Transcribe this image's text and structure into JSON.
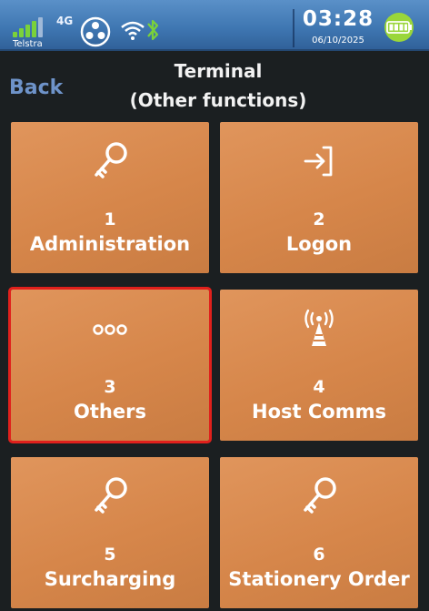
{
  "status_bar": {
    "network_type": "4G",
    "carrier": "Telstra",
    "time": "03:28",
    "date": "06/10/2025",
    "icons": [
      "signal-icon",
      "nfc-icon",
      "wifi-icon",
      "bluetooth-icon",
      "battery-icon"
    ],
    "colors": {
      "bar": "#3f77b2",
      "signal": "#7ad23a",
      "battery": "#9ad63a"
    }
  },
  "header": {
    "back_label": "Back",
    "title_line1": "Terminal",
    "title_line2": "(Other functions)"
  },
  "menu": {
    "items": [
      {
        "number": "1",
        "label": "Administration",
        "icon": "key-icon"
      },
      {
        "number": "2",
        "label": "Logon",
        "icon": "login-icon"
      },
      {
        "number": "3",
        "label": "Others",
        "icon": "more-icon",
        "selected": true
      },
      {
        "number": "4",
        "label": "Host Comms",
        "icon": "antenna-icon"
      },
      {
        "number": "5",
        "label": "Surcharging",
        "icon": "key-icon"
      },
      {
        "number": "6",
        "label": "Stationery Order",
        "icon": "key-icon"
      }
    ]
  },
  "colors": {
    "background": "#1b1f21",
    "tile": "#d6864a",
    "selection": "#e0201c",
    "back_link": "#6e93c9"
  }
}
